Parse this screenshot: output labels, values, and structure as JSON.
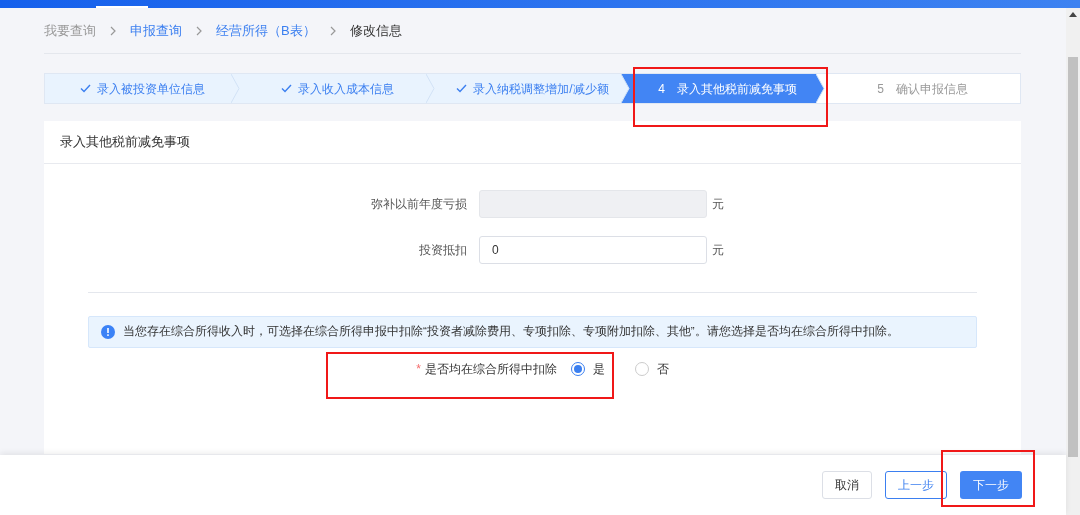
{
  "breadcrumb": [
    {
      "label": "我要查询",
      "link": false
    },
    {
      "label": "申报查询",
      "link": true
    },
    {
      "label": "经营所得（B表）",
      "link": true
    },
    {
      "label": "修改信息",
      "link": false
    }
  ],
  "steps": [
    {
      "label": "录入被投资单位信息",
      "completed": true,
      "selected": false
    },
    {
      "label": "录入收入成本信息",
      "completed": true,
      "selected": false
    },
    {
      "label": "录入纳税调整增加/减少额",
      "completed": true,
      "selected": false
    },
    {
      "number": "4",
      "label": "录入其他税前减免事项",
      "completed": false,
      "selected": true
    },
    {
      "number": "5",
      "label": "确认申报信息",
      "completed": false,
      "selected": false
    }
  ],
  "card": {
    "title": "录入其他税前减免事项",
    "fields": [
      {
        "label": "弥补以前年度亏损",
        "disabled": true,
        "unit": "元"
      },
      {
        "label": "投资抵扣",
        "value": "0",
        "disabled": false,
        "unit": "元"
      }
    ],
    "notice": "当您存在综合所得收入时，可选择在综合所得申报中扣除“投资者减除费用、专项扣除、专项附加扣除、其他”。请您选择是否均在综合所得中扣除。",
    "question": {
      "label": "是否均在综合所得中扣除",
      "required_mark": "*",
      "options": [
        {
          "label": "是",
          "selected": true
        },
        {
          "label": "否",
          "selected": false
        }
      ]
    }
  },
  "footer": {
    "buttons": [
      {
        "label": "取消",
        "kind": "default"
      },
      {
        "label": "上一步",
        "kind": "outline"
      },
      {
        "label": "下一步",
        "kind": "primary"
      }
    ]
  }
}
